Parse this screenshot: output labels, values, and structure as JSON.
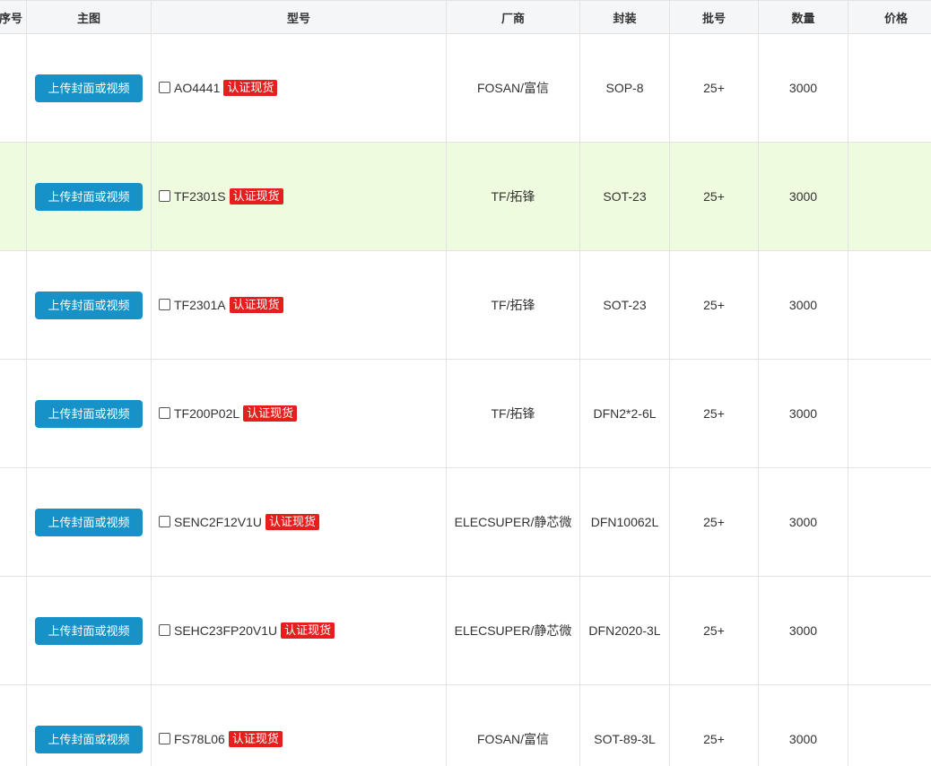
{
  "header": {
    "index": "序号",
    "image": "主图",
    "model": "型号",
    "maker": "厂商",
    "package": "封装",
    "batch": "批号",
    "qty": "数量",
    "price": "价格"
  },
  "upload_label": "上传封面或视频",
  "badge_label": "认证现货",
  "rows": [
    {
      "model": "AO4441",
      "maker": "FOSAN/富信",
      "package": "SOP-8",
      "batch": "25+",
      "qty": "3000"
    },
    {
      "model": "TF2301S",
      "maker": "TF/拓锋",
      "package": "SOT-23",
      "batch": "25+",
      "qty": "3000"
    },
    {
      "model": "TF2301A",
      "maker": "TF/拓锋",
      "package": "SOT-23",
      "batch": "25+",
      "qty": "3000"
    },
    {
      "model": "TF200P02L",
      "maker": "TF/拓锋",
      "package": "DFN2*2-6L",
      "batch": "25+",
      "qty": "3000"
    },
    {
      "model": "SENC2F12V1U",
      "maker": "ELECSUPER/静芯微",
      "package": "DFN10062L",
      "batch": "25+",
      "qty": "3000"
    },
    {
      "model": "SEHC23FP20V1U",
      "maker": "ELECSUPER/静芯微",
      "package": "DFN2020-3L",
      "batch": "25+",
      "qty": "3000"
    },
    {
      "model": "FS78L06",
      "maker": "FOSAN/富信",
      "package": "SOT-89-3L",
      "batch": "25+",
      "qty": "3000"
    }
  ],
  "colors": {
    "upload_button": "#1792c8",
    "badge": "#e61e1e",
    "highlight_row": "#eefbdf"
  }
}
